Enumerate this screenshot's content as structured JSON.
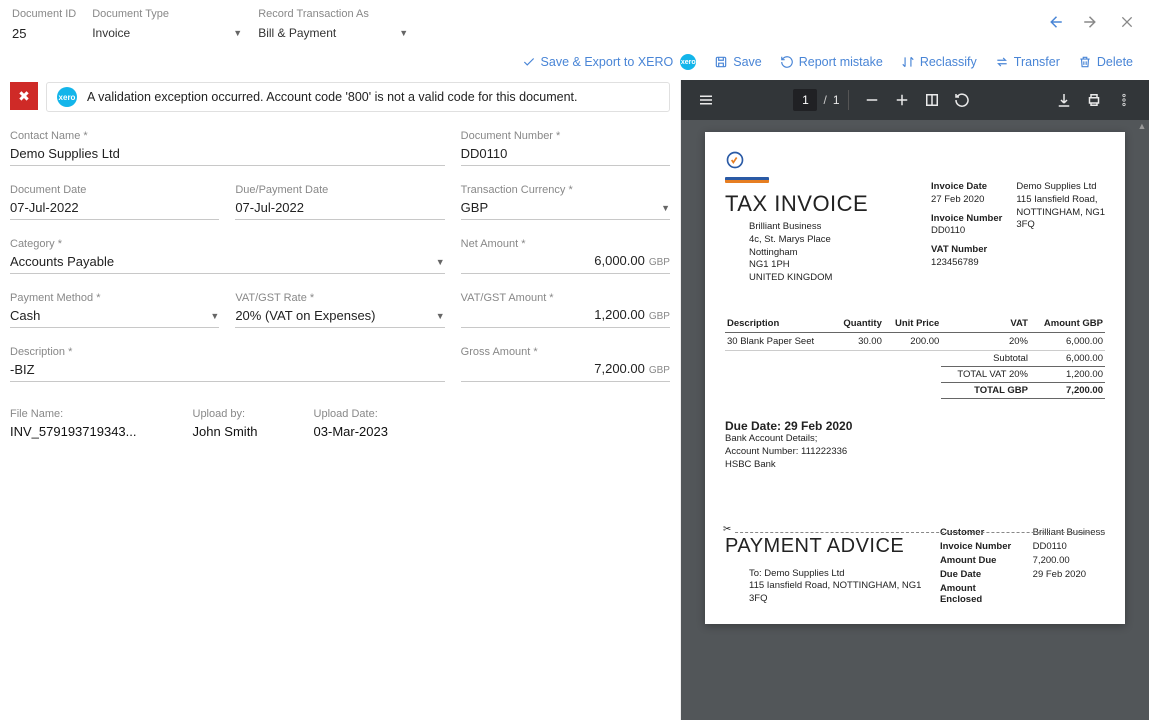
{
  "header": {
    "doc_id": {
      "label": "Document ID",
      "value": "25"
    },
    "doc_type": {
      "label": "Document Type",
      "value": "Invoice"
    },
    "record_as": {
      "label": "Record Transaction As",
      "value": "Bill & Payment"
    }
  },
  "actions": {
    "save_export": "Save & Export to XERO",
    "save": "Save",
    "report": "Report mistake",
    "reclassify": "Reclassify",
    "transfer": "Transfer",
    "delete": "Delete"
  },
  "alert": {
    "text": "A validation exception occurred. Account code '800' is not a valid code for this document."
  },
  "form": {
    "contact_name": {
      "label": "Contact Name *",
      "value": "Demo Supplies Ltd"
    },
    "doc_number": {
      "label": "Document Number *",
      "value": "DD0110"
    },
    "doc_date": {
      "label": "Document Date",
      "value": "07-Jul-2022"
    },
    "due_date": {
      "label": "Due/Payment Date",
      "value": "07-Jul-2022"
    },
    "currency": {
      "label": "Transaction Currency *",
      "value": "GBP"
    },
    "category": {
      "label": "Category *",
      "value": "Accounts Payable"
    },
    "net_amount": {
      "label": "Net Amount *",
      "value": "6,000.00",
      "curr": "GBP"
    },
    "payment_method": {
      "label": "Payment Method *",
      "value": "Cash"
    },
    "vat_rate": {
      "label": "VAT/GST Rate *",
      "value": "20% (VAT on Expenses)"
    },
    "vat_amount": {
      "label": "VAT/GST Amount *",
      "value": "1,200.00",
      "curr": "GBP"
    },
    "description": {
      "label": "Description *",
      "value": "-BIZ"
    },
    "gross_amount": {
      "label": "Gross Amount *",
      "value": "7,200.00",
      "curr": "GBP"
    }
  },
  "file": {
    "name_label": "File Name:",
    "name_value": "INV_579193719343...",
    "upload_by_label": "Upload by:",
    "upload_by_value": "John Smith",
    "upload_date_label": "Upload Date:",
    "upload_date_value": "03-Mar-2023"
  },
  "pdf": {
    "page_current": "1",
    "page_total": "1",
    "title": "TAX INVOICE",
    "bill_to": [
      "Brilliant Business",
      "4c, St. Marys Place",
      "Nottingham",
      "NG1 1PH",
      "UNITED KINGDOM"
    ],
    "meta": {
      "invoice_date_k": "Invoice Date",
      "invoice_date_v": "27 Feb 2020",
      "invoice_no_k": "Invoice Number",
      "invoice_no_v": "DD0110",
      "vat_no_k": "VAT Number",
      "vat_no_v": "123456789",
      "supplier": [
        "Demo Supplies Ltd",
        "115 Iansfield Road,",
        "NOTTINGHAM, NG1",
        "3FQ"
      ]
    },
    "table_headers": [
      "Description",
      "Quantity",
      "Unit Price",
      "VAT",
      "Amount GBP"
    ],
    "line": {
      "desc": "30 Blank Paper Seet",
      "qty": "30.00",
      "unit": "200.00",
      "vat": "20%",
      "amt": "6,000.00"
    },
    "subtotal_k": "Subtotal",
    "subtotal_v": "6,000.00",
    "vat_k": "TOTAL VAT 20%",
    "vat_v": "1,200.00",
    "total_k": "TOTAL GBP",
    "total_v": "7,200.00",
    "due": "Due Date: 29 Feb 2020",
    "bank": [
      "Bank Account Details;",
      "Account Number: 111222336",
      "HSBC Bank"
    ],
    "pa_title": "PAYMENT ADVICE",
    "pa_to": [
      "To: Demo Supplies Ltd",
      "115 Iansfield Road, NOTTINGHAM, NG1 3FQ"
    ],
    "pa_meta": {
      "customer_k": "Customer",
      "customer_v": "Brilliant Business",
      "invno_k": "Invoice Number",
      "invno_v": "DD0110",
      "amtdue_k": "Amount Due",
      "amtdue_v": "7,200.00",
      "duedate_k": "Due Date",
      "duedate_v": "29 Feb 2020",
      "enclosed_k": "Amount Enclosed",
      "enclosed_v": ""
    }
  }
}
